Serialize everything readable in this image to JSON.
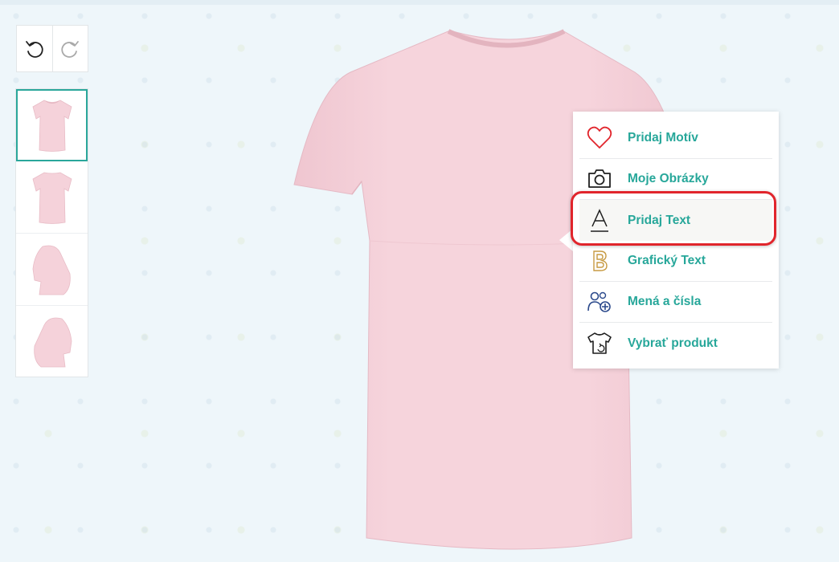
{
  "toolbar": {
    "undo_icon": "undo-icon",
    "redo_icon": "redo-icon"
  },
  "views": {
    "items": [
      {
        "name": "front",
        "active": true
      },
      {
        "name": "back",
        "active": false
      },
      {
        "name": "right-sleeve",
        "active": false
      },
      {
        "name": "left-sleeve",
        "active": false
      }
    ]
  },
  "product": {
    "color": "#f5d2da"
  },
  "menu": {
    "items": [
      {
        "label": "Pridaj Motív",
        "icon": "heart-icon"
      },
      {
        "label": "Moje Obrázky",
        "icon": "camera-icon"
      },
      {
        "label": "Pridaj Text",
        "icon": "text-a-icon"
      },
      {
        "label": "Grafický Text",
        "icon": "graphic-b-icon"
      },
      {
        "label": "Mená a čísla",
        "icon": "names-numbers-icon"
      },
      {
        "label": "Vybrať produkt",
        "icon": "tshirt-swap-icon"
      }
    ],
    "accent": "#27a79a",
    "highlight": "#e1252c"
  }
}
